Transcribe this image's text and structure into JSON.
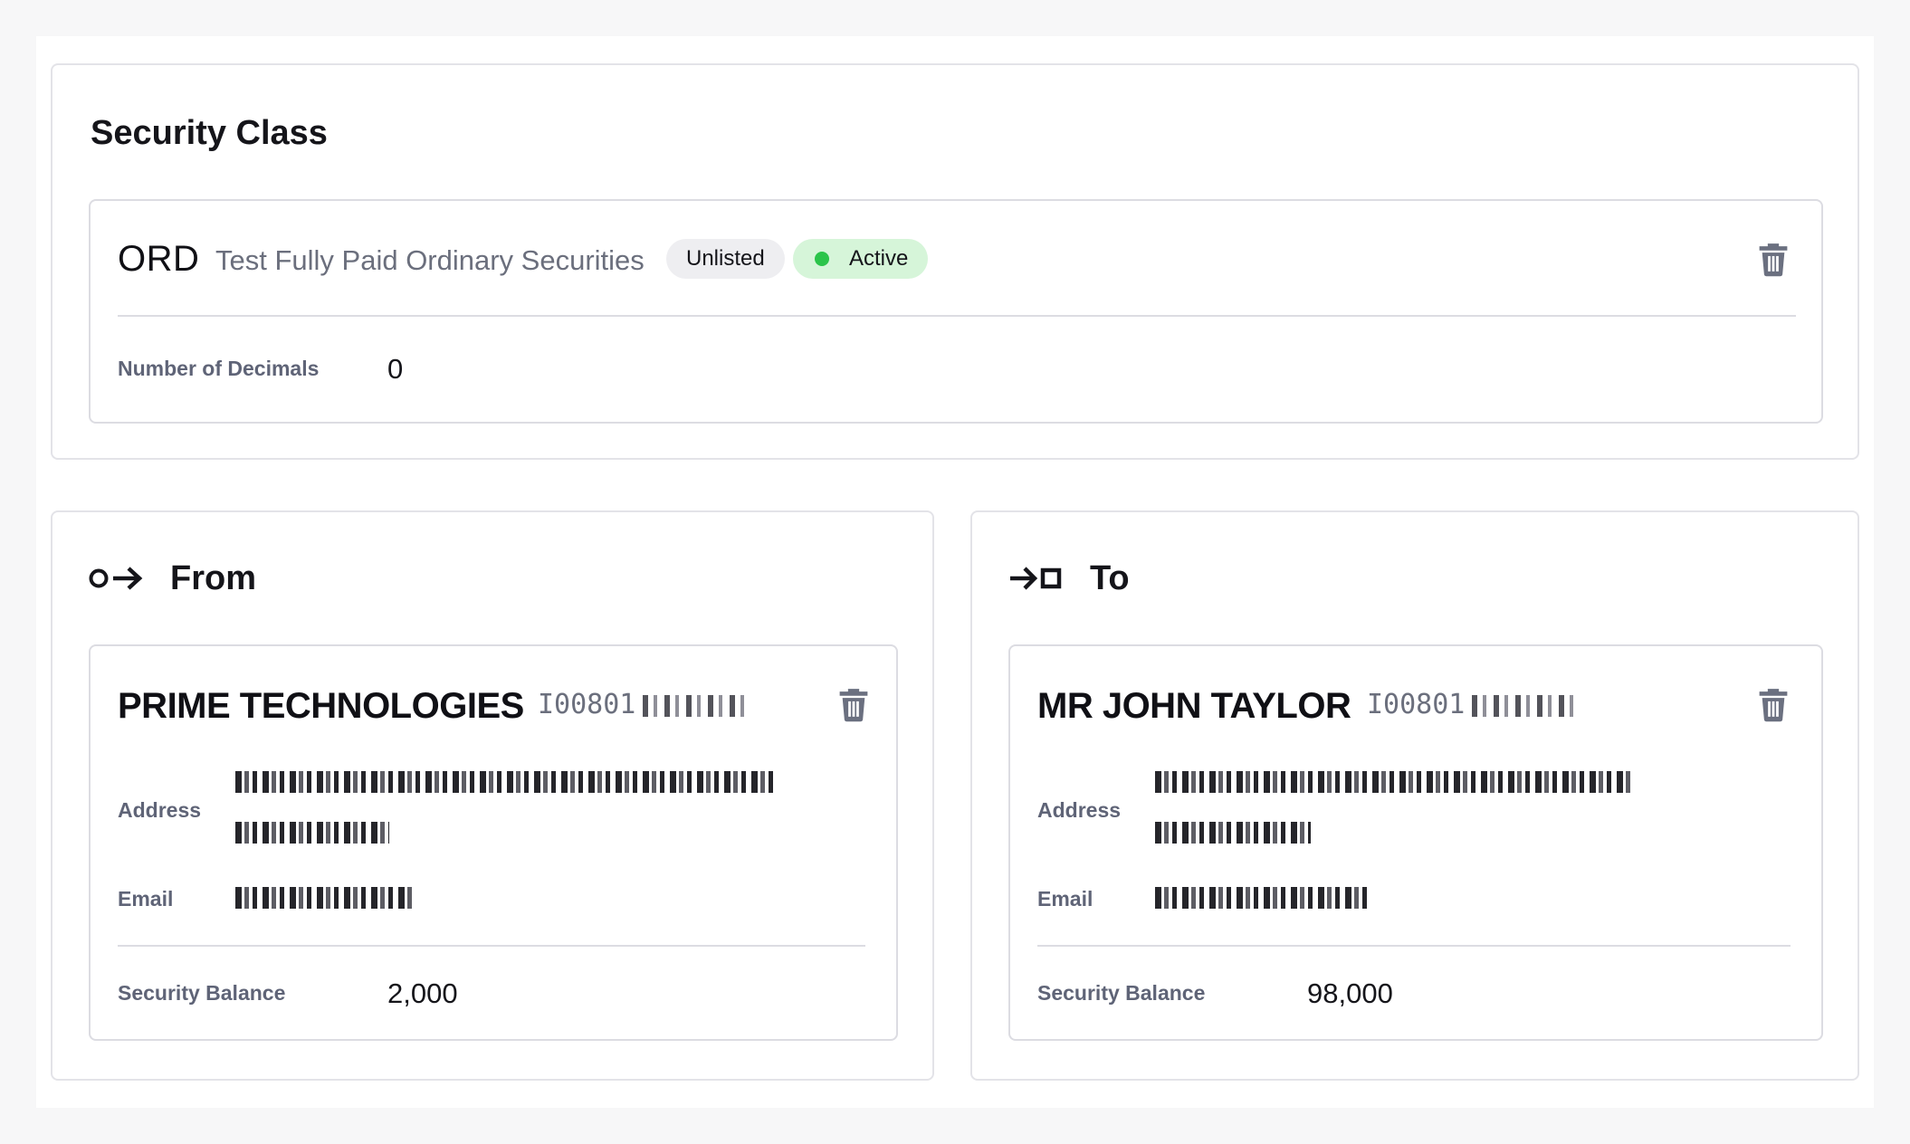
{
  "security_class": {
    "title": "Security Class",
    "code": "ORD",
    "description": "Test Fully Paid Ordinary Securities",
    "listing_badge": "Unlisted",
    "status_badge": "Active",
    "status_color": "#2bc44a",
    "decimals_label": "Number of Decimals",
    "decimals_value": "0"
  },
  "from": {
    "title": "From",
    "icon": "circle-arrow-right-icon",
    "holder_name": "PRIME TECHNOLOGIES",
    "holder_id": "I00801",
    "address_label": "Address",
    "email_label": "Email",
    "balance_label": "Security Balance",
    "balance_value": "2,000"
  },
  "to": {
    "title": "To",
    "icon": "arrow-right-square-icon",
    "holder_name": "MR JOHN TAYLOR",
    "holder_id": "I00801",
    "address_label": "Address",
    "email_label": "Email",
    "balance_label": "Security Balance",
    "balance_value": "98,000"
  },
  "icons": {
    "delete": "trash-icon"
  }
}
